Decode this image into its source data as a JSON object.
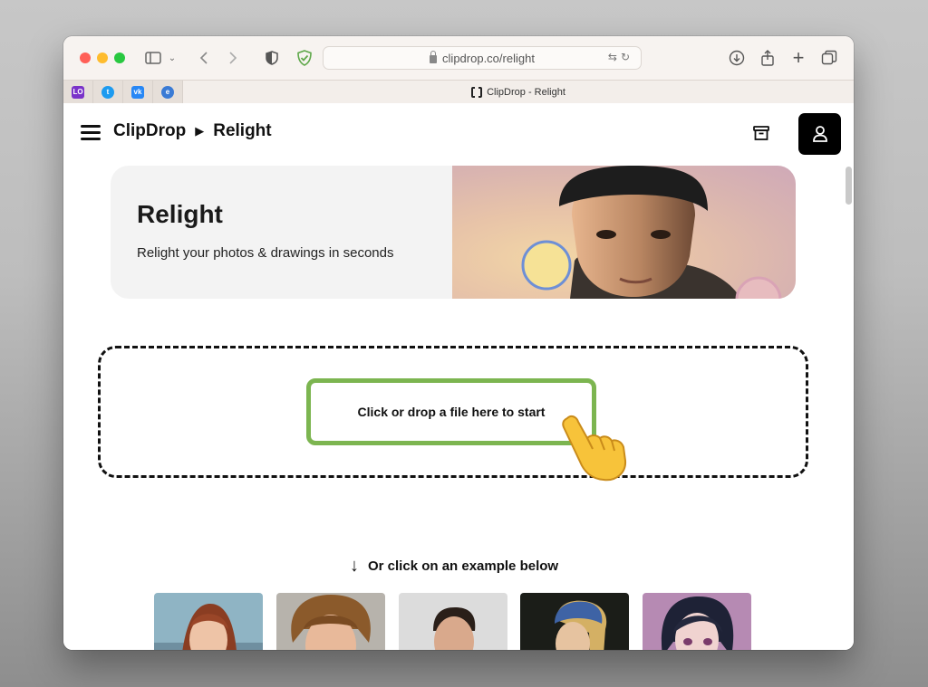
{
  "browser": {
    "url": "clipdrop.co/relight",
    "tab_title": "ClipDrop - Relight",
    "pinned_tabs": [
      {
        "name": "launchpad",
        "glyph": "LO",
        "color": "#7a33c9"
      },
      {
        "name": "twitter",
        "glyph": "t",
        "color": "#1d9bf0"
      },
      {
        "name": "vk",
        "glyph": "vk",
        "color": "#2787f5"
      },
      {
        "name": "app",
        "glyph": "e",
        "color": "#3a7bd5"
      }
    ]
  },
  "header": {
    "brand": "ClipDrop",
    "separator": "▶",
    "section": "Relight"
  },
  "hero": {
    "title": "Relight",
    "subtitle": "Relight your photos & drawings in seconds"
  },
  "upload": {
    "label": "Click or drop a file here to start",
    "accent": "#7cb550"
  },
  "examples": {
    "heading": "Or click on an example below",
    "items": [
      {
        "name": "red-haired-woman"
      },
      {
        "name": "curly-haired-man"
      },
      {
        "name": "man-dark-shirt"
      },
      {
        "name": "pearl-earring-painting"
      },
      {
        "name": "anime-girl"
      }
    ]
  }
}
